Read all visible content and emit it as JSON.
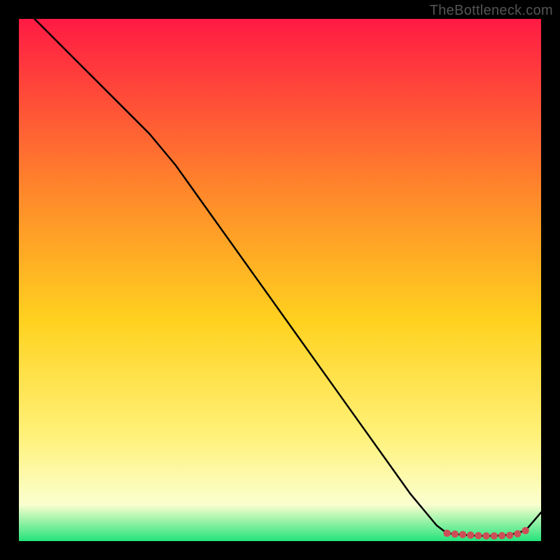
{
  "watermark": "TheBottleneck.com",
  "colors": {
    "top": "#ff1a44",
    "upper_mid": "#ff842b",
    "mid": "#ffd21f",
    "lower_mid": "#fff27a",
    "near_bottom": "#fbffcf",
    "bottom": "#24e37a",
    "line": "#000000",
    "marker": "#cc4f57",
    "background": "#000000"
  },
  "chart_data": {
    "type": "line",
    "title": "",
    "xlabel": "",
    "ylabel": "",
    "xlim": [
      0,
      100
    ],
    "ylim": [
      0,
      100
    ],
    "grid": false,
    "legend": false,
    "series": [
      {
        "name": "curve",
        "x": [
          0,
          5,
          10,
          15,
          20,
          25,
          30,
          35,
          40,
          45,
          50,
          55,
          60,
          65,
          70,
          75,
          80,
          82,
          85,
          88,
          91,
          94,
          97,
          100
        ],
        "y": [
          103,
          98,
          93,
          88,
          83,
          78,
          72,
          65,
          58,
          51,
          44,
          37,
          30,
          23,
          16,
          9,
          3,
          1.5,
          1.2,
          1.0,
          1.0,
          1.2,
          2.0,
          5.5
        ]
      }
    ],
    "highlight_markers": {
      "name": "optimal-range",
      "x": [
        82,
        83.5,
        85,
        86.5,
        88,
        89.5,
        91,
        92.5,
        94,
        95.5,
        97
      ],
      "y": [
        1.5,
        1.35,
        1.25,
        1.15,
        1.05,
        1.0,
        1.0,
        1.05,
        1.1,
        1.4,
        2.0
      ]
    }
  }
}
